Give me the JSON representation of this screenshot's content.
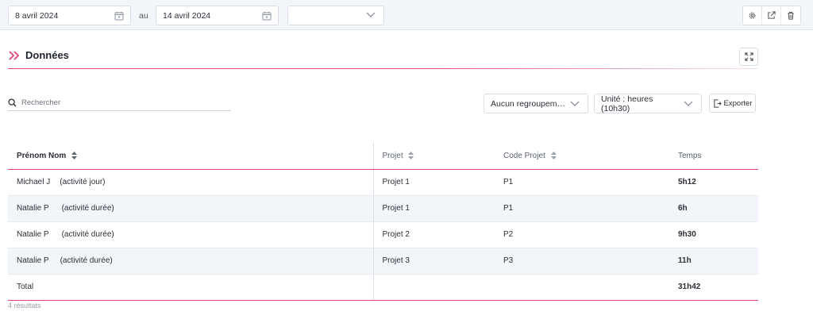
{
  "filters": {
    "start_date": "8 avril 2024",
    "separator": "au",
    "end_date": "14 avril 2024",
    "extra_select": ""
  },
  "section": {
    "title": "Données"
  },
  "search": {
    "placeholder": "Rechercher",
    "value": ""
  },
  "controls": {
    "grouping": "Aucun regroupem…",
    "unit": "Unité : heures (10h30)",
    "export_label": "Exporter"
  },
  "table": {
    "columns": [
      "Prénom Nom",
      "Projet",
      "Code Projet",
      "Temps"
    ],
    "rows": [
      {
        "name": "Michael J",
        "activity": "(activité jour)",
        "project": "Projet 1",
        "code": "P1",
        "time": "5h12"
      },
      {
        "name": "Natalie P",
        "activity": "(activité durée)",
        "project": "Projet 1",
        "code": "P1",
        "time": "6h"
      },
      {
        "name": "Natalie P",
        "activity": "(activité durée)",
        "project": "Projet 2",
        "code": "P2",
        "time": "9h30"
      },
      {
        "name": "Natalie P",
        "activity": "(activité durée)",
        "project": "Projet 3",
        "code": "P3",
        "time": "11h"
      }
    ],
    "total_label": "Total",
    "total_time": "31h42"
  },
  "footer": {
    "results": "4 résultats"
  },
  "colors": {
    "accent": "#e0457b",
    "row_alt": "#f2f6fb",
    "topbar_bg": "#f2f5fa"
  }
}
